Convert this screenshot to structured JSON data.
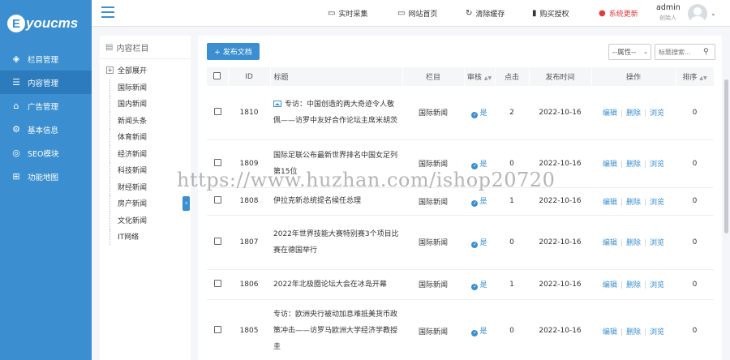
{
  "logo": {
    "initial": "E",
    "text": "youcms"
  },
  "sidebar": {
    "items": [
      {
        "label": "栏目管理",
        "icon": "layers-icon",
        "glyph": "◈"
      },
      {
        "label": "内容管理",
        "icon": "document-icon",
        "glyph": "☰"
      },
      {
        "label": "广告管理",
        "icon": "image-icon",
        "glyph": "⌂"
      },
      {
        "label": "基本信息",
        "icon": "gear-icon",
        "glyph": "⚙"
      },
      {
        "label": "SEO模块",
        "icon": "globe-icon",
        "glyph": "◎"
      },
      {
        "label": "功能地图",
        "icon": "grid-icon",
        "glyph": "⊞"
      }
    ]
  },
  "topbar": {
    "collect": "实时采集",
    "site_home": "网站首页",
    "clear_cache": "清除缓存",
    "buy_license": "购买授权",
    "system_update": "系统更新",
    "user_name": "admin",
    "user_role": "创始人"
  },
  "tree": {
    "header": "内容栏目",
    "expand_all": "全部展开",
    "categories": [
      "国际新闻",
      "国内新闻",
      "新闻头条",
      "体育新闻",
      "经济新闻",
      "科技新闻",
      "财经新闻",
      "房产新闻",
      "文化新闻",
      "IT网络"
    ]
  },
  "toolbar": {
    "publish": "+ 发布文档",
    "attr_select": "--属性--",
    "search_placeholder": "标题搜索..."
  },
  "table": {
    "headers": {
      "id": "ID",
      "title": "标题",
      "column": "栏目",
      "audit": "审核",
      "clicks": "点击",
      "time": "发布时间",
      "actions": "操作",
      "sort": "排序"
    },
    "action_labels": {
      "edit": "编辑",
      "delete": "删除",
      "view": "浏览"
    },
    "rows": [
      {
        "id": "1810",
        "title": "专访：中国创造的两大奇迹令人敬佩——访罗中友好合作论坛主席米胡茨",
        "column": "国际新闻",
        "audit": "是",
        "clicks": "2",
        "time": "2022-10-16",
        "sort": "0"
      },
      {
        "id": "1809",
        "title": "国际足联公布最新世界排名中国女足列第15位",
        "column": "国际新闻",
        "audit": "是",
        "clicks": "0",
        "time": "2022-10-16",
        "sort": "0"
      },
      {
        "id": "1808",
        "title": "伊拉克新总统提名候任总理",
        "column": "国际新闻",
        "audit": "是",
        "clicks": "1",
        "time": "2022-10-16",
        "sort": "0"
      },
      {
        "id": "1807",
        "title": "2022年世界技能大赛特别赛3个项目比赛在德国举行",
        "column": "国际新闻",
        "audit": "是",
        "clicks": "0",
        "time": "2022-10-16",
        "sort": "0"
      },
      {
        "id": "1806",
        "title": "2022年北极圈论坛大会在冰岛开幕",
        "column": "国际新闻",
        "audit": "是",
        "clicks": "1",
        "time": "2022-10-16",
        "sort": "0"
      },
      {
        "id": "1805",
        "title": "专访：欧洲央行被动加息难抵美货币政策冲击——访罗马欧洲大学经济学教授圭",
        "column": "国际新闻",
        "audit": "是",
        "clicks": "0",
        "time": "2022-10-16",
        "sort": "0"
      }
    ]
  },
  "watermark": "https://www.huzhan.com/ishop20720"
}
